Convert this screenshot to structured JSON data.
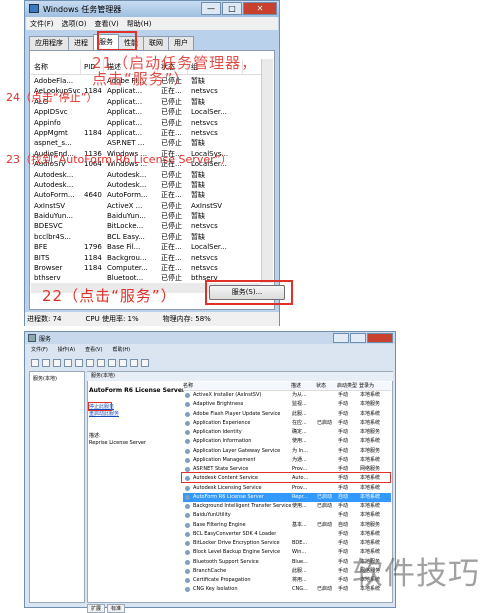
{
  "task_manager": {
    "title": "Windows 任务管理器",
    "menu": [
      "文件(F)",
      "选项(O)",
      "查看(V)",
      "帮助(H)"
    ],
    "tabs": [
      "应用程序",
      "进程",
      "服务",
      "性能",
      "联网",
      "用户"
    ],
    "active_tab": 2,
    "columns": [
      "名称",
      "PID",
      "描述",
      "状态",
      "组"
    ],
    "rows": [
      [
        "AdobeFla...",
        "",
        "Adobe Fl...",
        "已停止",
        "暂缺"
      ],
      [
        "AeLookupSvc",
        "1184",
        "Applicat...",
        "正在...",
        "netsvcs"
      ],
      [
        "ALG",
        "",
        "Applicat...",
        "已停止",
        "暂缺"
      ],
      [
        "AppIDSvc",
        "",
        "Applicat...",
        "已停止",
        "LocalSer..."
      ],
      [
        "Appinfo",
        "",
        "Applicat...",
        "已停止",
        "netsvcs"
      ],
      [
        "AppMgmt",
        "1184",
        "Applicat...",
        "正在...",
        "netsvcs"
      ],
      [
        "aspnet_s...",
        "",
        "ASP.NET ...",
        "已停止",
        "暂缺"
      ],
      [
        "AudioEnd...",
        "1136",
        "Windows ...",
        "正在...",
        "LocalSys..."
      ],
      [
        "AudioSrv",
        "1064",
        "Windows ...",
        "正在...",
        "LocalSer..."
      ],
      [
        "Autodesk...",
        "",
        "Autodesk...",
        "已停止",
        "暂缺"
      ],
      [
        "Autodesk...",
        "",
        "Autodesk...",
        "已停止",
        "暂缺"
      ],
      [
        "AutoForm...",
        "4640",
        "AutoForm...",
        "正在...",
        "暂缺"
      ],
      [
        "AxInstSV",
        "",
        "ActiveX ...",
        "已停止",
        "AxInstSV"
      ],
      [
        "BaiduYun...",
        "",
        "BaiduYun...",
        "已停止",
        "暂缺"
      ],
      [
        "BDESVC",
        "",
        "BitLocke...",
        "已停止",
        "netsvcs"
      ],
      [
        "bcclbr4S...",
        "",
        "BCL Easy...",
        "已停止",
        "暂缺"
      ],
      [
        "BFE",
        "1796",
        "Base Fil...",
        "正在...",
        "LocalSer..."
      ],
      [
        "BITS",
        "1184",
        "Backgrou...",
        "正在...",
        "netsvcs"
      ],
      [
        "Browser",
        "1184",
        "Computer...",
        "正在...",
        "netsvcs"
      ],
      [
        "bthserv",
        "",
        "Bluetoot...",
        "已停止",
        "bthserv"
      ]
    ],
    "services_button": "服务(S)...",
    "status": {
      "processes": "进程数: 74",
      "cpu": "CPU 使用率: 1%",
      "memory": "物理内存: 58%"
    },
    "window_buttons": [
      "—",
      "□",
      "✕"
    ]
  },
  "annotations": {
    "a21": "21（启动任务管理器，点击“服务”）",
    "a22": "22（点击“服务”）",
    "a24": "24（点击“停止”）",
    "a23": "23（找到“AutoForm R6 License Server”）"
  },
  "services_window": {
    "title": "服务",
    "menu": [
      "文件(F)",
      "操作(A)",
      "查看(V)",
      "帮助(H)"
    ],
    "tree_node": "服务(本地)",
    "header": "服务(本地)",
    "selected_name": "AutoForm R6 License Server",
    "links": [
      "停止此服务",
      "重启动此服务"
    ],
    "desc_label": "描述:",
    "desc_value": "Reprise License Server",
    "columns": [
      "名称",
      "描述",
      "状态",
      "启动类型",
      "登录为"
    ],
    "rows": [
      [
        "ActiveX Installer (AxInstSV)",
        "为从...",
        "",
        "手动",
        "本地系统"
      ],
      [
        "Adaptive Brightness",
        "监视...",
        "",
        "手动",
        "本地服务"
      ],
      [
        "Adobe Flash Player Update Service",
        "此服...",
        "",
        "手动",
        "本地系统"
      ],
      [
        "Application Experience",
        "在应...",
        "已启动",
        "手动",
        "本地系统"
      ],
      [
        "Application Identity",
        "确定...",
        "",
        "手动",
        "本地服务"
      ],
      [
        "Application Information",
        "使用...",
        "",
        "手动",
        "本地系统"
      ],
      [
        "Application Layer Gateway Service",
        "为 In...",
        "",
        "手动",
        "本地服务"
      ],
      [
        "Application Management",
        "为通...",
        "",
        "手动",
        "本地系统"
      ],
      [
        "ASP.NET State Service",
        "Prov...",
        "",
        "手动",
        "网络服务"
      ],
      [
        "Autodesk Content Service",
        "Auto...",
        "",
        "手动",
        "本地系统"
      ],
      [
        "Autodesk Licensing Service",
        "Prov...",
        "",
        "手动",
        "本地系统"
      ],
      [
        "AutoForm R6 License Server",
        "Repr...",
        "已启动",
        "自动",
        "本地系统"
      ],
      [
        "Background Intelligent Transfer Service",
        "使用...",
        "已启动",
        "手动",
        "本地系统"
      ],
      [
        "BaiduYunUtility",
        "",
        "",
        "手动",
        "本地系统"
      ],
      [
        "Base Filtering Engine",
        "基本...",
        "已启动",
        "自动",
        "本地服务"
      ],
      [
        "BCL EasyConverter SDK 4 Loader",
        "",
        "",
        "手动",
        "本地系统"
      ],
      [
        "BitLocker Drive Encryption Service",
        "BDE...",
        "",
        "手动",
        "本地系统"
      ],
      [
        "Block Level Backup Engine Service",
        "Win...",
        "",
        "手动",
        "本地系统"
      ],
      [
        "Bluetooth Support Service",
        "Blue...",
        "",
        "手动",
        "本地服务"
      ],
      [
        "BranchCache",
        "此服...",
        "",
        "手动",
        "网络服务"
      ],
      [
        "Certificate Propagation",
        "将用...",
        "",
        "手动",
        "本地系统"
      ],
      [
        "CNG Key Isolation",
        "CNG...",
        "已启动",
        "手动",
        "本地系统"
      ]
    ],
    "selected_row": 11,
    "bottom_tabs": [
      "扩展",
      "标准"
    ]
  },
  "watermark": "软件技巧"
}
